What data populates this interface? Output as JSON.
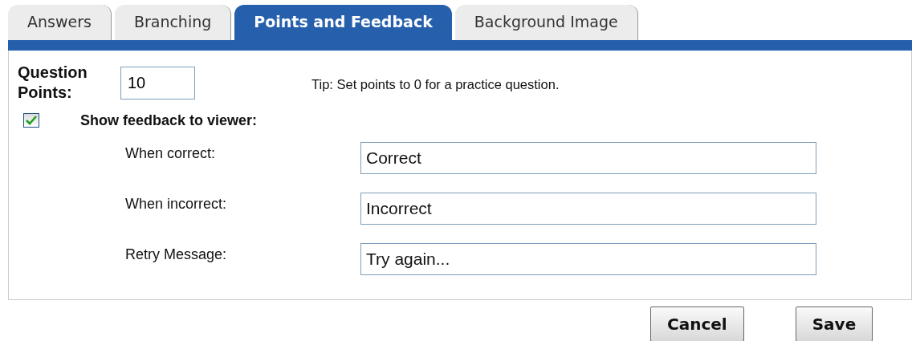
{
  "tabs": [
    {
      "label": "Answers",
      "selected": false
    },
    {
      "label": "Branching",
      "selected": false
    },
    {
      "label": "Points and Feedback",
      "selected": true
    },
    {
      "label": "Background Image",
      "selected": false
    }
  ],
  "points": {
    "label": "Question Points:",
    "value": "10",
    "tip": "Tip: Set points to 0 for a practice question."
  },
  "show_feedback": {
    "label": "Show feedback to viewer:",
    "checked": true
  },
  "feedback_fields": [
    {
      "label": "When correct:",
      "value": "Correct"
    },
    {
      "label": "When incorrect:",
      "value": "Incorrect"
    },
    {
      "label": "Retry Message:",
      "value": "Try again..."
    }
  ],
  "buttons": [
    "Cancel",
    "Save"
  ]
}
